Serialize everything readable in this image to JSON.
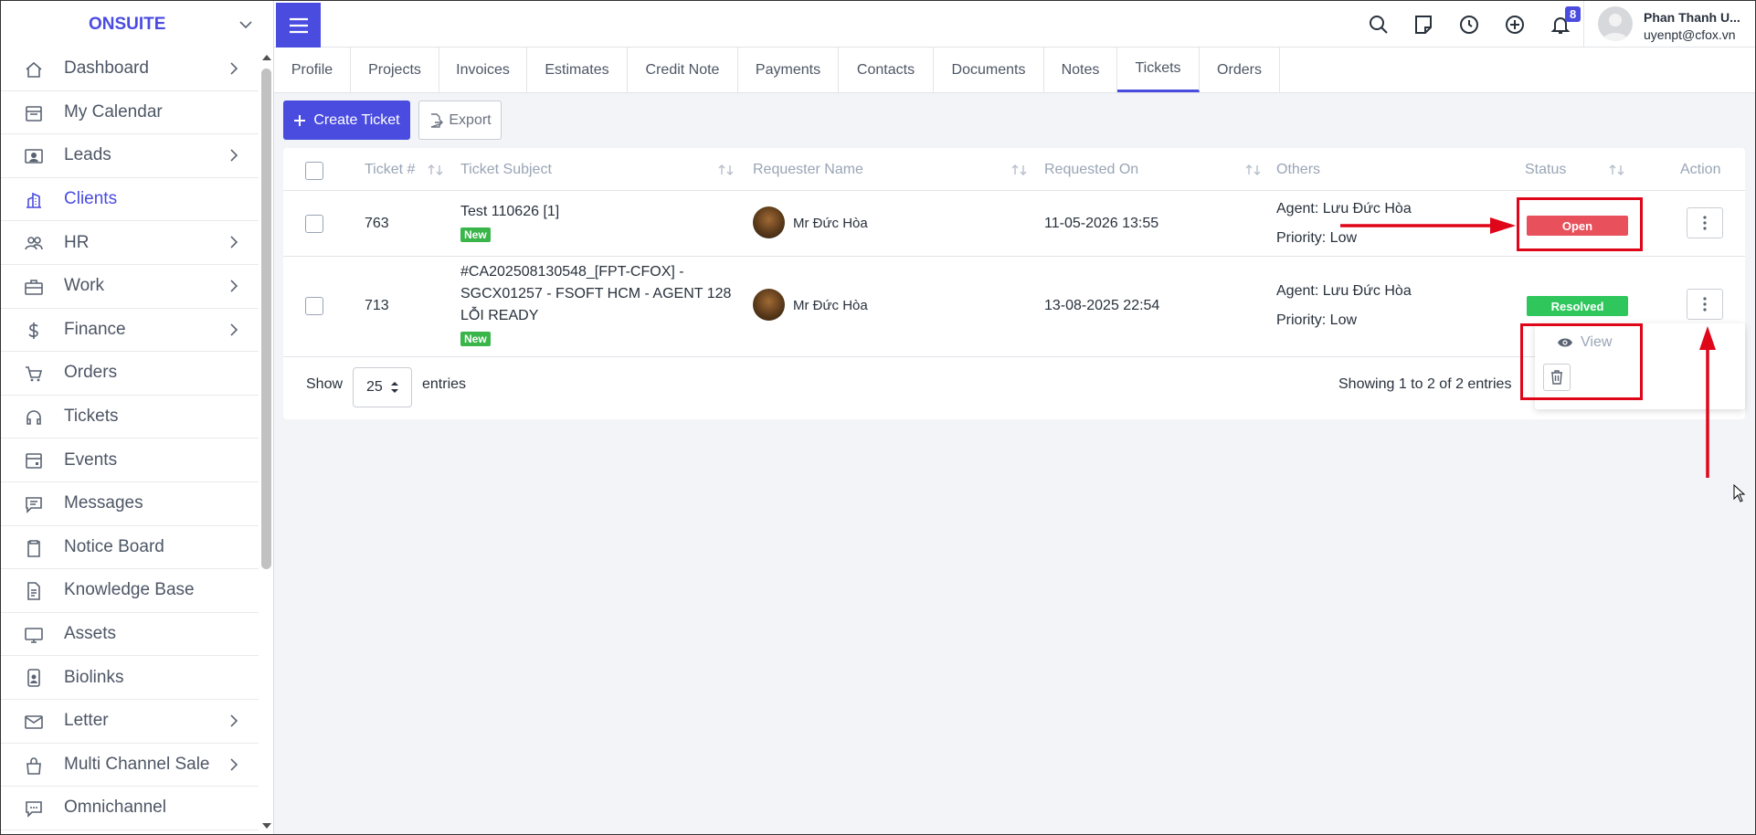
{
  "brand": "ONSUITE",
  "sidebar": {
    "items": [
      {
        "label": "Dashboard",
        "icon": "home-icon",
        "arrow": true
      },
      {
        "label": "My Calendar",
        "icon": "calendar-icon",
        "arrow": false
      },
      {
        "label": "Leads",
        "icon": "id-card-icon",
        "arrow": true
      },
      {
        "label": "Clients",
        "icon": "building-icon",
        "arrow": false,
        "active": true
      },
      {
        "label": "HR",
        "icon": "people-icon",
        "arrow": true
      },
      {
        "label": "Work",
        "icon": "briefcase-icon",
        "arrow": true
      },
      {
        "label": "Finance",
        "icon": "dollar-icon",
        "arrow": true
      },
      {
        "label": "Orders",
        "icon": "cart-icon",
        "arrow": false
      },
      {
        "label": "Tickets",
        "icon": "headset-icon",
        "arrow": false
      },
      {
        "label": "Events",
        "icon": "calendar-event-icon",
        "arrow": false
      },
      {
        "label": "Messages",
        "icon": "message-icon",
        "arrow": false
      },
      {
        "label": "Notice Board",
        "icon": "clipboard-icon",
        "arrow": false
      },
      {
        "label": "Knowledge Base",
        "icon": "document-icon",
        "arrow": false
      },
      {
        "label": "Assets",
        "icon": "monitor-icon",
        "arrow": false
      },
      {
        "label": "Biolinks",
        "icon": "badge-icon",
        "arrow": false
      },
      {
        "label": "Letter",
        "icon": "envelope-icon",
        "arrow": true
      },
      {
        "label": "Multi Channel Sale",
        "icon": "bag-icon",
        "arrow": true
      },
      {
        "label": "Omnichannel",
        "icon": "chat-icon",
        "arrow": false
      }
    ]
  },
  "topbar": {
    "notification_count": "8",
    "user_name": "Phan Thanh U...",
    "user_email": "uyenpt@cfox.vn"
  },
  "tabs": [
    "Profile",
    "Projects",
    "Invoices",
    "Estimates",
    "Credit Note",
    "Payments",
    "Contacts",
    "Documents",
    "Notes",
    "Tickets",
    "Orders"
  ],
  "active_tab": "Tickets",
  "buttons": {
    "create": "Create Ticket",
    "export": "Export"
  },
  "table": {
    "headers": [
      "Ticket #",
      "Ticket Subject",
      "Requester Name",
      "Requested On",
      "Others",
      "Status",
      "Action"
    ],
    "rows": [
      {
        "id": "763",
        "subject_lines": [
          "Test 110626 [1]"
        ],
        "badge": "New",
        "requester": "Mr Đức Hòa",
        "requested_on": "11-05-2026 13:55",
        "agent": "Agent: Lưu Đức Hòa",
        "priority": "Priority: Low",
        "status": "Open",
        "status_color": "#e8505b"
      },
      {
        "id": "713",
        "subject_lines": [
          "#CA202508130548_[FPT-CFOX] -",
          "SGCX01257 - FSOFT HCM - AGENT 128",
          "LỖI READY"
        ],
        "badge": "New",
        "requester": "Mr Đức Hòa",
        "requested_on": "13-08-2025 22:54",
        "agent": "Agent: Lưu Đức Hòa",
        "priority": "Priority: Low",
        "status": "Resolved",
        "status_color": "#2fc75c"
      }
    ]
  },
  "footer": {
    "show": "Show",
    "page_size": "25",
    "entries": "entries",
    "summary": "Showing 1 to 2 of 2 entries"
  },
  "dropdown": {
    "view": "View"
  },
  "colors": {
    "accent": "#4a4ce0",
    "annotation": "#e0061a"
  }
}
